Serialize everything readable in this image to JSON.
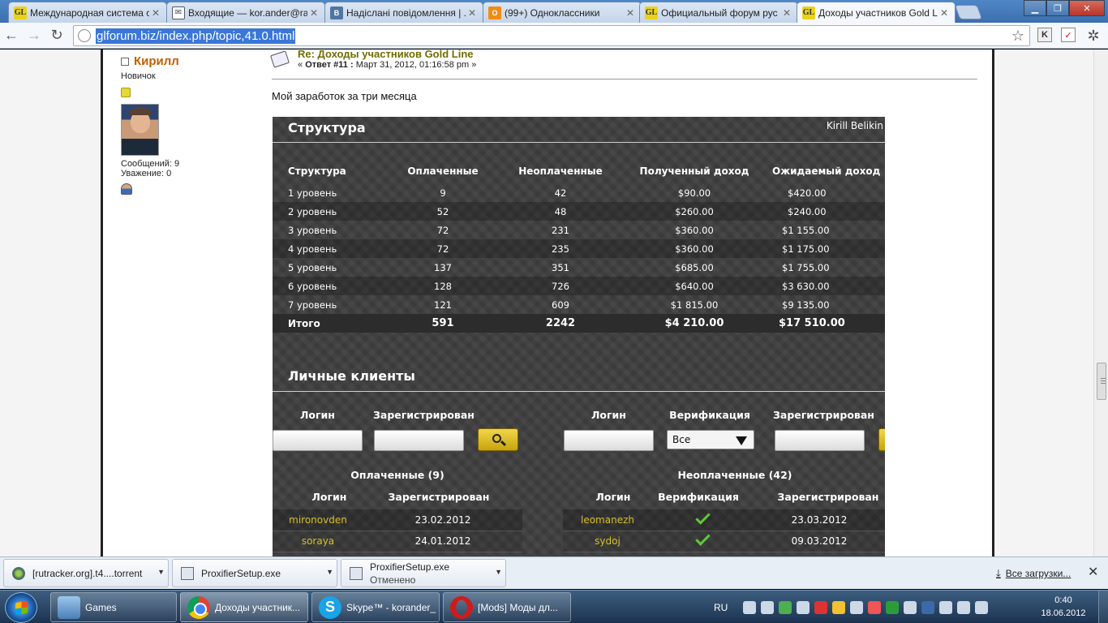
{
  "browser": {
    "tabs": [
      {
        "icon": "gl-icon",
        "title": "Международная система с",
        "active": false
      },
      {
        "icon": "mail-icon",
        "title": "Входящие — kor.ander@ra",
        "active": false
      },
      {
        "icon": "vk-icon",
        "title": "Надіслані повідомлення | ...",
        "active": false
      },
      {
        "icon": "odnoklassniki-icon",
        "title": "(99+) Одноклассники",
        "active": false
      },
      {
        "icon": "gl-icon",
        "title": "Официальный форум рус",
        "active": false
      },
      {
        "icon": "gl-icon",
        "title": "Доходы участников Gold L",
        "active": true
      }
    ],
    "url": "glforum.biz/index.php/topic,41.0.html",
    "extensions": [
      "K",
      "✓"
    ]
  },
  "poster": {
    "name": "Кирилл",
    "rank": "Новичок",
    "posts": "Сообщений: 9",
    "respect": "Уважение: 0"
  },
  "post": {
    "subject": "Re: Доходы участников Gold Line",
    "meta_prefix": "«",
    "reply_label": "Ответ #11 :",
    "date": "Март 31, 2012, 01:16:58 pm",
    "meta_suffix": "»",
    "body": "Мой заработок за три месяца"
  },
  "dashboard": {
    "title": "Структура",
    "owner": "Kirill Belikin",
    "structure": {
      "headers": [
        "Структура",
        "Оплаченные",
        "Неоплаченные",
        "Полученный доход",
        "Ожидаемый доход"
      ],
      "rows": [
        [
          "1 уровень",
          "9",
          "42",
          "$90.00",
          "$420.00"
        ],
        [
          "2 уровень",
          "52",
          "48",
          "$260.00",
          "$240.00"
        ],
        [
          "3 уровень",
          "72",
          "231",
          "$360.00",
          "$1 155.00"
        ],
        [
          "4 уровень",
          "72",
          "235",
          "$360.00",
          "$1 175.00"
        ],
        [
          "5 уровень",
          "137",
          "351",
          "$685.00",
          "$1 755.00"
        ],
        [
          "6 уровень",
          "128",
          "726",
          "$640.00",
          "$3 630.00"
        ],
        [
          "7 уровень",
          "121",
          "609",
          "$1 815.00",
          "$9 135.00"
        ]
      ],
      "total": [
        "Итого",
        "591",
        "2242",
        "$4 210.00",
        "$17 510.00"
      ]
    },
    "clients_title": "Личные клиенты",
    "filters": {
      "login": "Логин",
      "registered": "Зарегистрирован",
      "verification": "Верификация",
      "verification_value": "Все"
    },
    "paid": {
      "title": "Оплаченные (9)",
      "col_login": "Логин",
      "col_registered": "Зарегистрирован",
      "rows": [
        {
          "login": "mironovden",
          "date": "23.02.2012"
        },
        {
          "login": "soraya",
          "date": "24.01.2012"
        }
      ]
    },
    "unpaid": {
      "title": "Неоплаченные (42)",
      "col_login": "Логин",
      "col_verification": "Верификация",
      "col_registered": "Зарегистрирован",
      "rows": [
        {
          "login": "leomanezh",
          "verified": true,
          "date": "23.03.2012"
        },
        {
          "login": "sydoj",
          "verified": true,
          "date": "09.03.2012"
        }
      ]
    }
  },
  "downloads": {
    "items": [
      {
        "name": "[rutracker.org].t4....torrent",
        "status": ""
      },
      {
        "name": "ProxifierSetup.exe",
        "status": ""
      },
      {
        "name": "ProxifierSetup.exe",
        "status": "Отменено"
      }
    ],
    "all_label": "Все загрузки..."
  },
  "taskbar": {
    "buttons": [
      {
        "icon": "folder-icon",
        "label": "Games"
      },
      {
        "icon": "chrome-icon",
        "label": "Доходы участник..."
      },
      {
        "icon": "skype-icon",
        "label": "Skype™ - korander_"
      },
      {
        "icon": "opera-icon",
        "label": "[Mods] Моды дл..."
      }
    ],
    "language": "RU",
    "time": "0:40",
    "date": "18.06.2012"
  }
}
